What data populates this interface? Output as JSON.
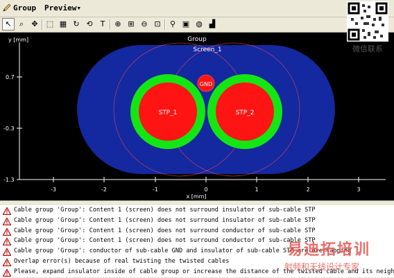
{
  "window": {
    "title": "Group",
    "menu_label": "Preview▾"
  },
  "toolbar": {
    "buttons": [
      {
        "name": "select-pointer-button",
        "icon": "cursor-arrow-icon",
        "glyph": "↖"
      },
      {
        "name": "zoom-lens-button",
        "icon": "magnifier-icon",
        "glyph": "⌕"
      },
      {
        "name": "pan-button",
        "icon": "move-arrows-icon",
        "glyph": "✥"
      },
      {
        "name": "select-region-button",
        "icon": "select-region-icon",
        "glyph": "⬚"
      },
      {
        "name": "grid-button",
        "icon": "grid-icon",
        "glyph": "▦"
      },
      {
        "name": "rotate-button",
        "icon": "rotate-icon",
        "glyph": "↻"
      },
      {
        "name": "twist-button",
        "icon": "twist-icon",
        "glyph": "⟲"
      },
      {
        "name": "text-button",
        "icon": "text-icon",
        "glyph": "T"
      },
      {
        "name": "zoom-in-button",
        "icon": "zoom-in-icon",
        "glyph": "⊕"
      },
      {
        "name": "zoom-fit-button",
        "icon": "zoom-fit-icon",
        "glyph": "⊞"
      },
      {
        "name": "zoom-out-button",
        "icon": "zoom-out-icon",
        "glyph": "⊖"
      },
      {
        "name": "zoom-window-button",
        "icon": "zoom-window-icon",
        "glyph": "⊡"
      },
      {
        "name": "measure-button",
        "icon": "measure-pin-icon",
        "glyph": "⚲"
      },
      {
        "name": "image-button",
        "icon": "image-icon",
        "glyph": "▣"
      },
      {
        "name": "properties-button",
        "icon": "properties-icon",
        "glyph": "◍"
      },
      {
        "name": "stamp-button",
        "icon": "stamp-icon",
        "glyph": "▟"
      }
    ]
  },
  "plot": {
    "title": "Group",
    "screen_label": "Screen_1",
    "y_axis_label": "y [mm]",
    "x_axis_label": "x [mm]",
    "y_ticks": [
      "0.7",
      "-0.3",
      "-1.3"
    ],
    "x_ticks": [
      "-3",
      "-2",
      "-1",
      "0",
      "1",
      "2",
      "3"
    ],
    "cable_left_label": "STP_1",
    "cable_right_label": "STP_2",
    "gnd_label": "GND",
    "colors": {
      "background": "#000000",
      "screen_fill": "#1428a0",
      "insulator": "#14e614",
      "conductor": "#ff1414",
      "outline": "#ff5050",
      "axis": "#ffffff"
    }
  },
  "messages": [
    {
      "icon": "warning-icon",
      "text": "Cable group 'Group': Content 1 (screen) does not surround insulator of sub-cable STP"
    },
    {
      "icon": "warning-icon",
      "text": "Cable group 'Group': Content 1 (screen) does not surround insulator of sub-cable STP"
    },
    {
      "icon": "warning-icon",
      "text": "Cable group 'Group': Content 1 (screen) does not surround conductor of sub-cable STP"
    },
    {
      "icon": "warning-icon",
      "text": "Cable group 'Group': Content 1 (screen) does not surround conductor of sub-cable STP"
    },
    {
      "icon": "warning-icon",
      "text": "Cable group 'Group': conductor of sub-cable GND and insulator of sub-cable STP are overlapping"
    },
    {
      "icon": "warning-icon",
      "text": "Overlap error(s) because of real twisting the twisted cables"
    },
    {
      "icon": "warning-icon",
      "text": "Please, expand insulator inside of cable group or increase the distance of the twisted cable and its neighbors"
    }
  ],
  "overlay": {
    "qr_caption": "微信联系",
    "watermark_title": "易迪拓培训",
    "watermark_subtitle": "射频和天线设计专家"
  }
}
